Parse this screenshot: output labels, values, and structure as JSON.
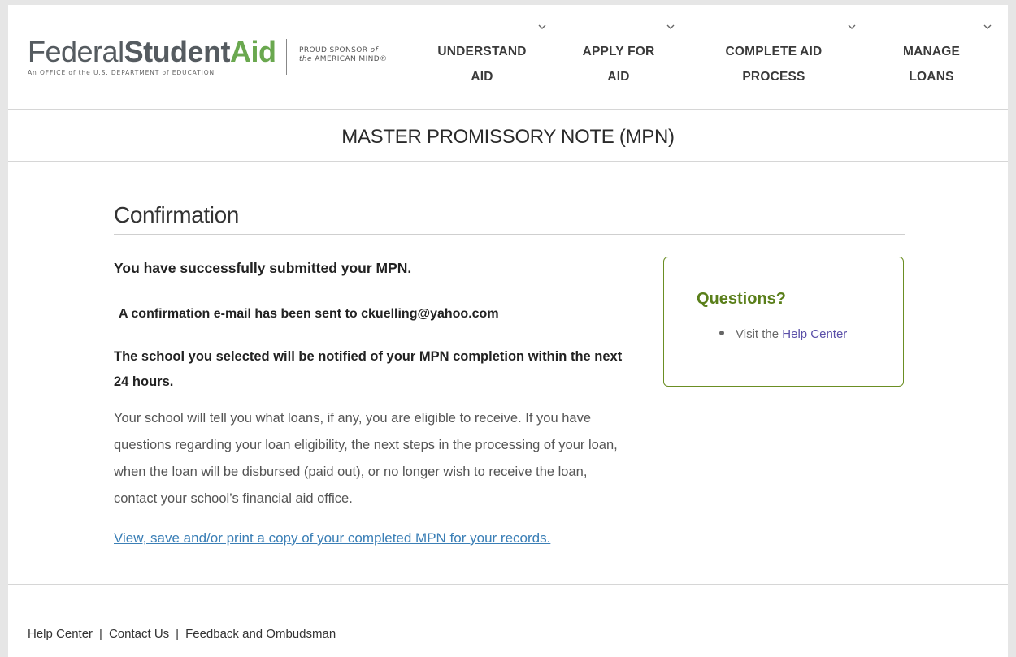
{
  "header": {
    "logo": {
      "federal": "Federal",
      "student": "Student",
      "aid": "Aid",
      "subtitle": "An OFFICE of the U.S. DEPARTMENT of EDUCATION"
    },
    "sponsor": {
      "line1_prefix": "PROUD SPONSOR",
      "line1_suffix": "of",
      "line2_prefix": "the",
      "line2_suffix": "AMERICAN MIND®"
    },
    "nav": [
      {
        "line1": "UNDERSTAND",
        "line2": "AID",
        "icon": "chevron-down-icon"
      },
      {
        "line1": "APPLY FOR",
        "line2": "AID",
        "icon": "chevron-down-icon"
      },
      {
        "line1": "COMPLETE AID",
        "line2": "PROCESS",
        "icon": "chevron-down-icon"
      },
      {
        "line1": "MANAGE",
        "line2": "LOANS",
        "icon": "chevron-down-icon"
      }
    ]
  },
  "title_bar": {
    "title": "MASTER PROMISSORY NOTE (MPN)"
  },
  "main": {
    "heading": "Confirmation",
    "success": "You have successfully submitted your MPN.",
    "email_notice": "A confirmation e-mail has been sent to ckuelling@yahoo.com",
    "school_notice": "The school you selected will be notified of your MPN completion within the next 24 hours.",
    "body": "Your school will tell you what loans, if any, you are eligible to receive. If you have questions regarding your loan eligibility, the next steps in the processing of your loan, when the loan will be disbursed (paid out), or no longer wish to receive the loan, contact your school’s financial aid office.",
    "view_link": "View, save and/or print a copy of your completed MPN for your records."
  },
  "questions": {
    "title": "Questions?",
    "item_prefix": "Visit the",
    "item_link": "Help Center"
  },
  "footer": {
    "links": [
      "Help Center",
      "Contact Us",
      "Feedback and Ombudsman"
    ],
    "separator": "|"
  },
  "colors": {
    "brand_green": "#6aa84f",
    "questions_green": "#5a7f1a",
    "link_blue": "#3b7fb6",
    "help_link_purple": "#5a4fa8"
  }
}
